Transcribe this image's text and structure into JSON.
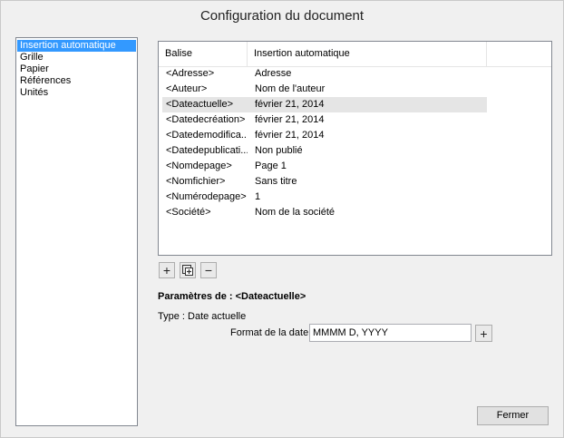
{
  "window": {
    "title": "Configuration du document"
  },
  "sidebar": {
    "items": [
      {
        "label": "Insertion automatique",
        "selected": true
      },
      {
        "label": "Grille"
      },
      {
        "label": "Papier"
      },
      {
        "label": "Références"
      },
      {
        "label": "Unités"
      }
    ]
  },
  "table": {
    "headers": [
      "Balise",
      "Insertion automatique",
      ""
    ],
    "rows": [
      {
        "tag": "<Adresse>",
        "value": "Adresse"
      },
      {
        "tag": "<Auteur>",
        "value": "Nom de l'auteur"
      },
      {
        "tag": "<Dateactuelle>",
        "value": "février 21, 2014",
        "selected": true
      },
      {
        "tag": "<Datedecréation>",
        "value": "février 21, 2014"
      },
      {
        "tag": "<Datedemodifica...",
        "value": "février 21, 2014"
      },
      {
        "tag": "<Datedepublicati...",
        "value": "Non publié"
      },
      {
        "tag": "<Nomdepage>",
        "value": "Page 1"
      },
      {
        "tag": "<Nomfichier>",
        "value": "Sans titre"
      },
      {
        "tag": "<Numérodepage>",
        "value": "1"
      },
      {
        "tag": "<Société>",
        "value": "Nom de la société"
      }
    ]
  },
  "toolbar": {
    "add_label": "+",
    "remove_label": "−",
    "add_icon": "add-icon",
    "insert_icon": "insert-field-icon",
    "remove_icon": "remove-icon"
  },
  "params": {
    "title": "Paramètres de : <Dateactuelle>",
    "type_text": "Type : Date actuelle",
    "date_format_label": "Format de la date:",
    "date_format_value": "MMMM D, YYYY",
    "date_format_plus": "+"
  },
  "footer": {
    "close_label": "Fermer"
  },
  "colors": {
    "selection": "#3399ff",
    "row_highlight": "#e5e5e5",
    "background": "#f0f0f0"
  }
}
